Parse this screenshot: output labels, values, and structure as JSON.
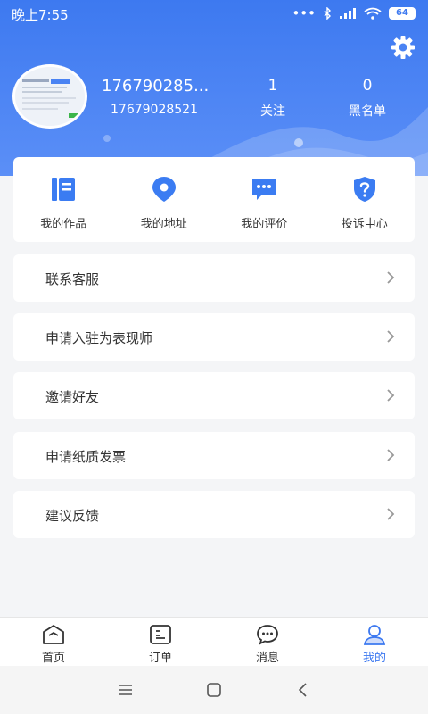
{
  "status_bar": {
    "time": "晚上7:55",
    "battery": "64"
  },
  "profile": {
    "name": "176790285...",
    "id": "17679028521"
  },
  "stats": [
    {
      "value": "1",
      "label": "关注"
    },
    {
      "value": "0",
      "label": "黑名单"
    }
  ],
  "quick_actions": [
    {
      "label": "我的作品",
      "icon": "works-icon"
    },
    {
      "label": "我的地址",
      "icon": "location-pin-icon"
    },
    {
      "label": "我的评价",
      "icon": "comment-icon"
    },
    {
      "label": "投诉中心",
      "icon": "shield-question-icon"
    }
  ],
  "menu": [
    {
      "label": "联系客服"
    },
    {
      "label": "申请入驻为表现师"
    },
    {
      "label": "邀请好友"
    },
    {
      "label": "申请纸质发票"
    },
    {
      "label": "建议反馈"
    }
  ],
  "tabs": [
    {
      "label": "首页",
      "icon": "home-icon"
    },
    {
      "label": "订单",
      "icon": "order-icon"
    },
    {
      "label": "消息",
      "icon": "message-icon"
    },
    {
      "label": "我的",
      "icon": "profile-icon",
      "active": true
    }
  ],
  "colors": {
    "accent": "#3d79f0",
    "icon_blue": "#3b7cf2",
    "background": "#f4f5f7"
  }
}
